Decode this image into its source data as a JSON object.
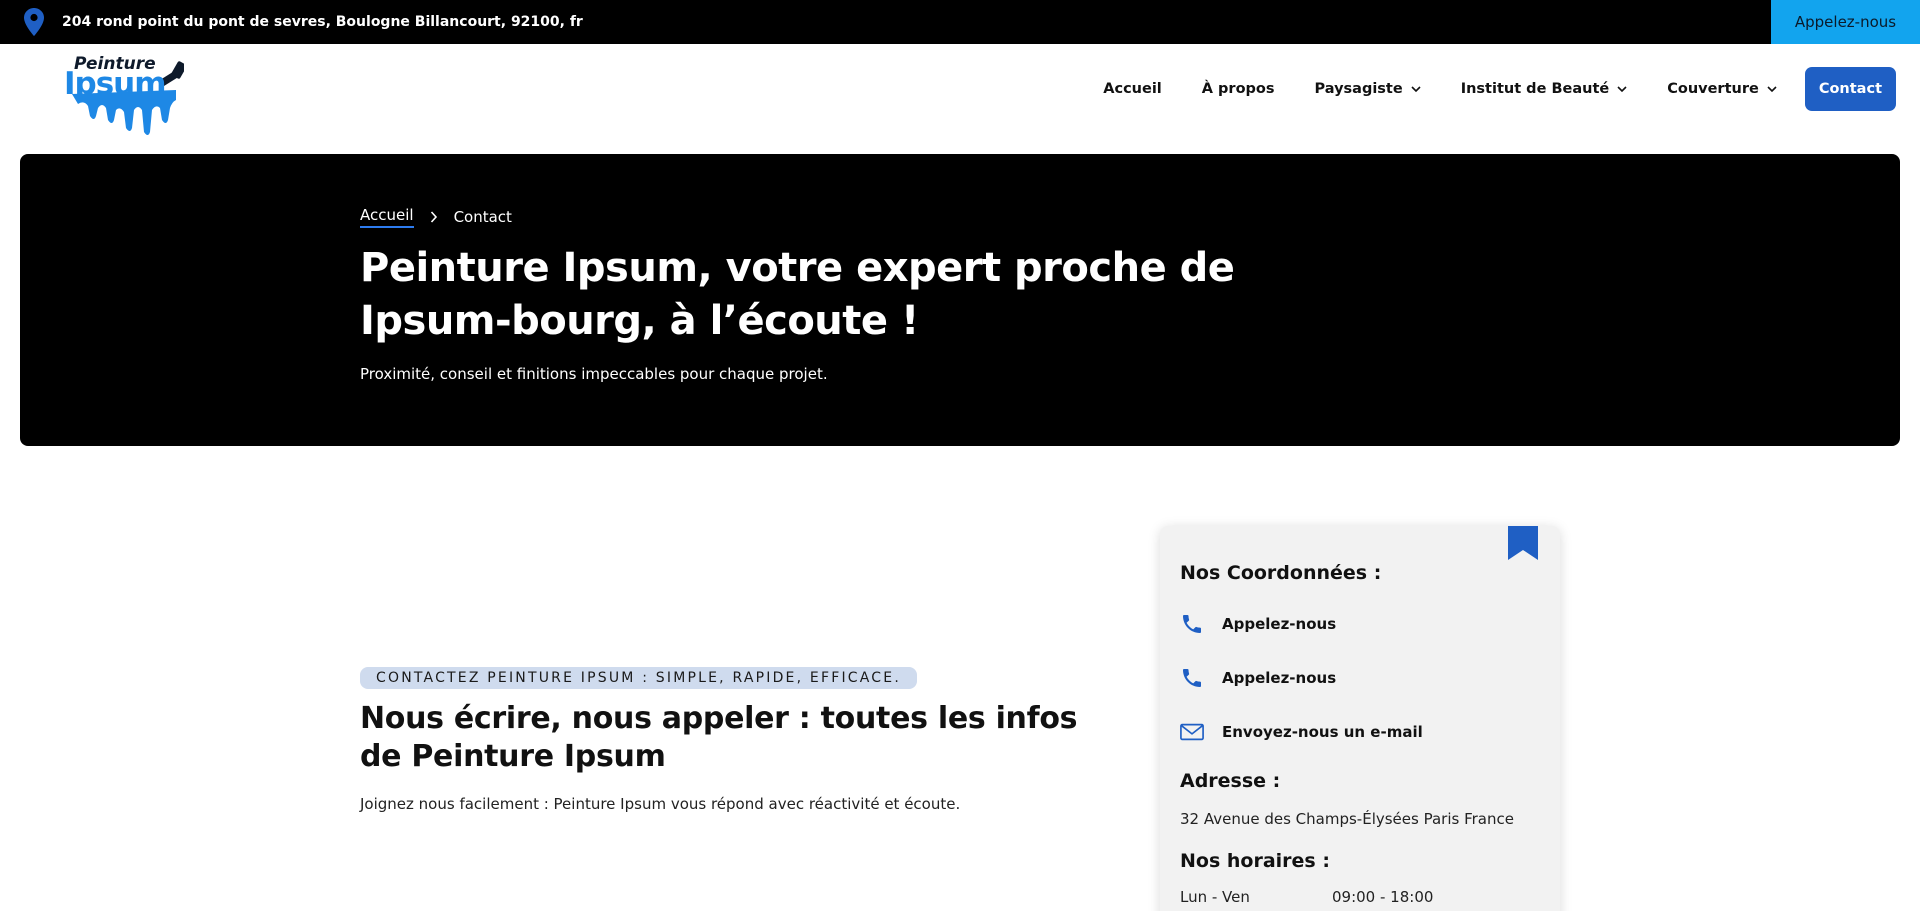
{
  "topbar": {
    "address": "204 rond point du pont de sevres, Boulogne Billancourt, 92100, fr",
    "call_label": "Appelez-nous",
    "pin_icon": "location-pin-icon"
  },
  "logo": {
    "line1": "Peinture",
    "line2": "Ipsum"
  },
  "nav": {
    "items": [
      {
        "label": "Accueil"
      },
      {
        "label": "À propos"
      },
      {
        "label": "Paysagiste"
      },
      {
        "label": "Institut de Beauté"
      },
      {
        "label": "Couverture"
      }
    ],
    "cta": "Contact"
  },
  "hero": {
    "breadcrumb": {
      "home": "Accueil",
      "current": "Contact"
    },
    "title": "Peinture Ipsum, votre expert proche de Ipsum-bourg, à l’écoute !",
    "subtitle": "Proximité, conseil et finitions impeccables pour chaque projet."
  },
  "contact_section": {
    "eyebrow": "CONTACTEZ PEINTURE IPSUM : SIMPLE, RAPIDE, EFFICACE.",
    "heading": "Nous écrire, nous appeler : toutes les infos de Peinture Ipsum",
    "text": "Joignez nous facilement : Peinture Ipsum vous répond avec réactivité et écoute."
  },
  "card": {
    "coords_title": "Nos Coordonnées :",
    "phone1": "Appelez-nous",
    "phone2": "Appelez-nous",
    "email": "Envoyez-nous un e-mail",
    "address_title": "Adresse :",
    "address": "32 Avenue des Champs-Élysées Paris France",
    "hours_title": "Nos horaires :",
    "hours_day": "Lun - Ven",
    "hours_time": "09:00 - 18:00"
  },
  "colors": {
    "accent": "#1f5fc4",
    "topbar_call": "#12a4ee",
    "hero_bg": "#000000",
    "eyebrow_bg": "#cfdbee"
  }
}
